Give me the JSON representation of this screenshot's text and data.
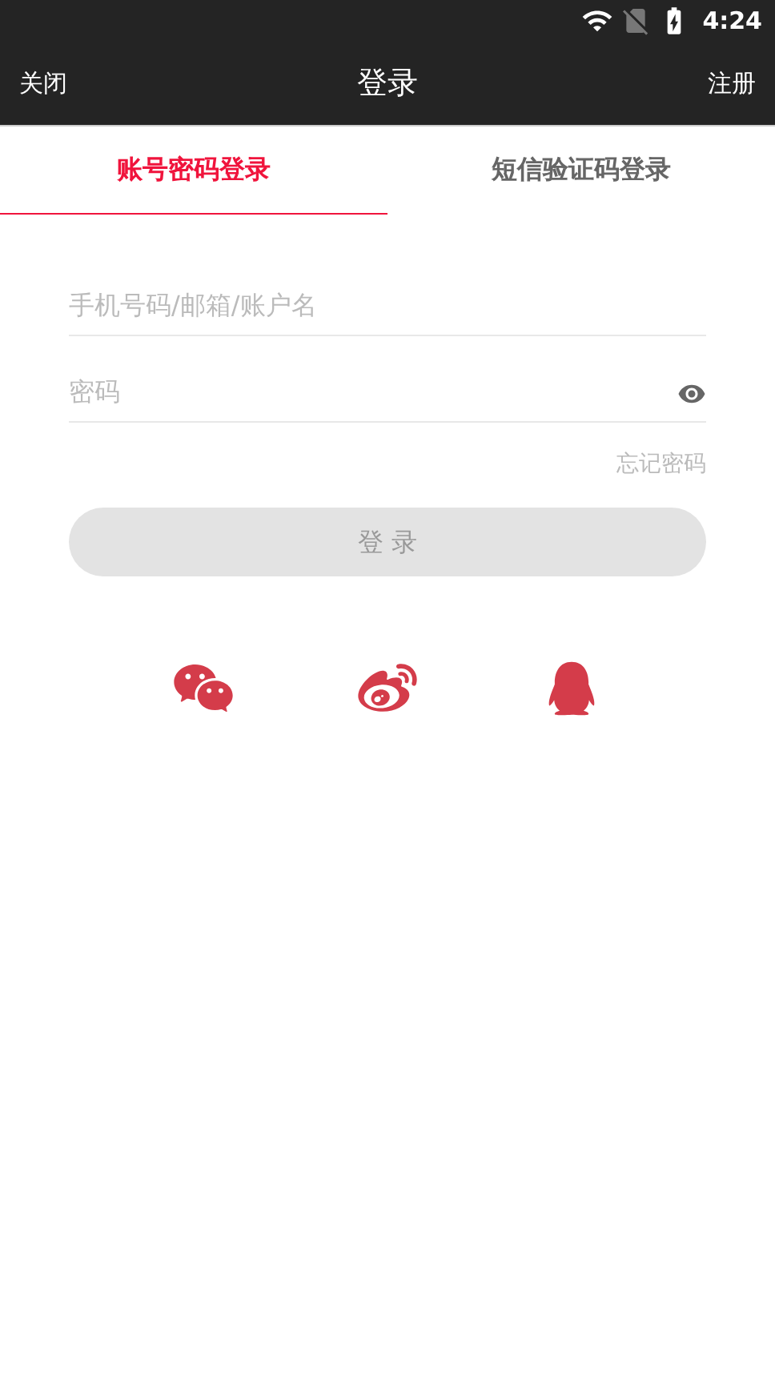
{
  "status_bar": {
    "time": "4:24"
  },
  "header": {
    "left": "关闭",
    "title": "登录",
    "right": "注册"
  },
  "tabs": [
    {
      "label": "账号密码登录",
      "selected": true
    },
    {
      "label": "短信验证码登录",
      "selected": false
    }
  ],
  "fields": [
    {
      "placeholder": "手机号码/邮箱/账户名",
      "kind": "text"
    },
    {
      "placeholder": "密码",
      "kind": "password"
    }
  ],
  "forgot_link": "忘记密码",
  "login_button": {
    "label": "登 录",
    "disabled": true
  },
  "social": [
    {
      "kind": "chat"
    },
    {
      "kind": "weibo"
    },
    {
      "kind": "penguin"
    }
  ]
}
